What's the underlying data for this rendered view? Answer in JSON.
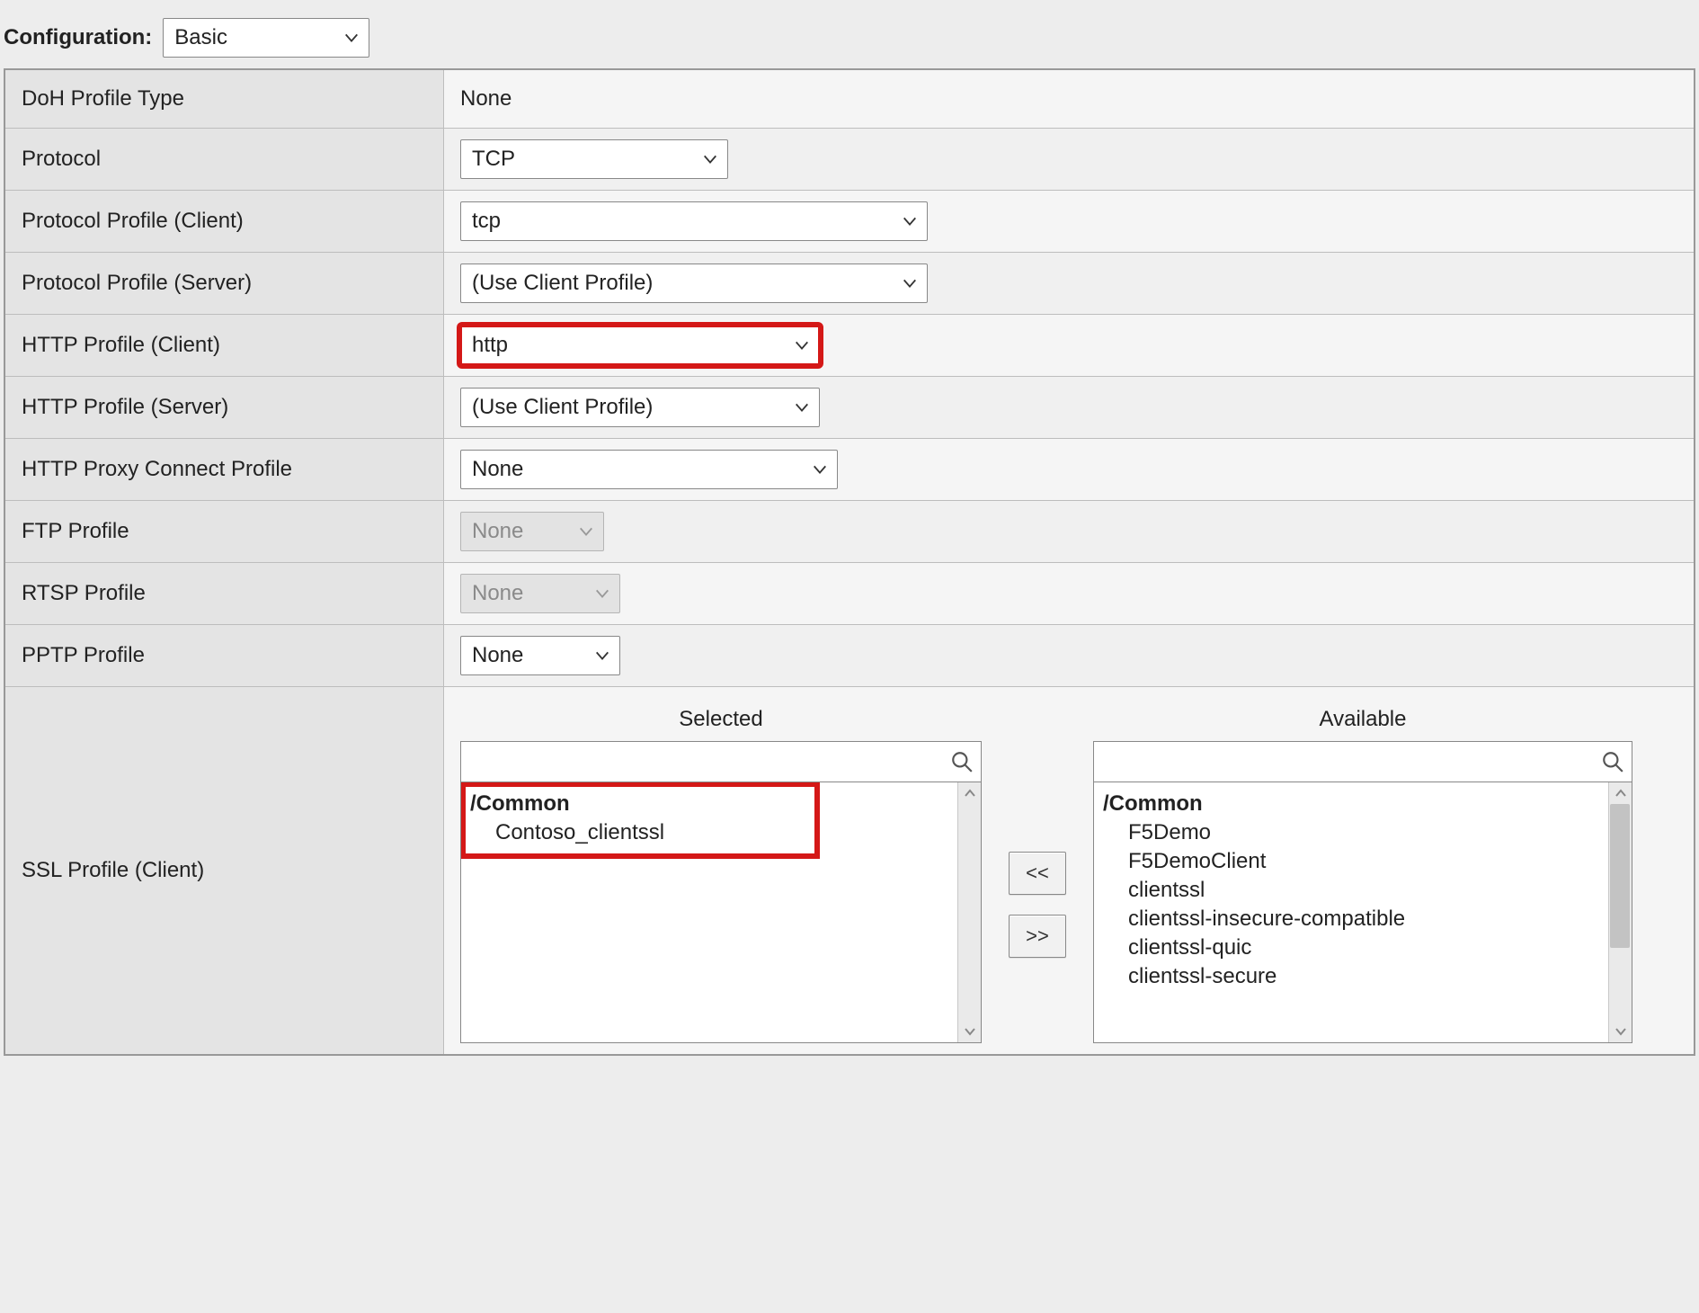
{
  "config_label": "Configuration:",
  "config_select_value": "Basic",
  "rows": {
    "doh_type": {
      "label": "DoH Profile Type",
      "value": "None"
    },
    "protocol": {
      "label": "Protocol",
      "value": "TCP"
    },
    "pp_client": {
      "label": "Protocol Profile (Client)",
      "value": "tcp"
    },
    "pp_server": {
      "label": "Protocol Profile (Server)",
      "value": "(Use Client Profile)"
    },
    "http_client": {
      "label": "HTTP Profile (Client)",
      "value": "http"
    },
    "http_server": {
      "label": "HTTP Profile (Server)",
      "value": "(Use Client Profile)"
    },
    "http_proxy": {
      "label": "HTTP Proxy Connect Profile",
      "value": "None"
    },
    "ftp": {
      "label": "FTP Profile",
      "value": "None"
    },
    "rtsp": {
      "label": "RTSP Profile",
      "value": "None"
    },
    "pptp": {
      "label": "PPTP Profile",
      "value": "None"
    },
    "ssl_client": {
      "label": "SSL Profile (Client)"
    }
  },
  "picker": {
    "selected_title": "Selected",
    "available_title": "Available",
    "move_left": "<<",
    "move_right": ">>",
    "group_label": "/Common",
    "selected_items": [
      "Contoso_clientssl"
    ],
    "available_items": [
      "F5Demo",
      "F5DemoClient",
      "clientssl",
      "clientssl-insecure-compatible",
      "clientssl-quic",
      "clientssl-secure"
    ]
  }
}
